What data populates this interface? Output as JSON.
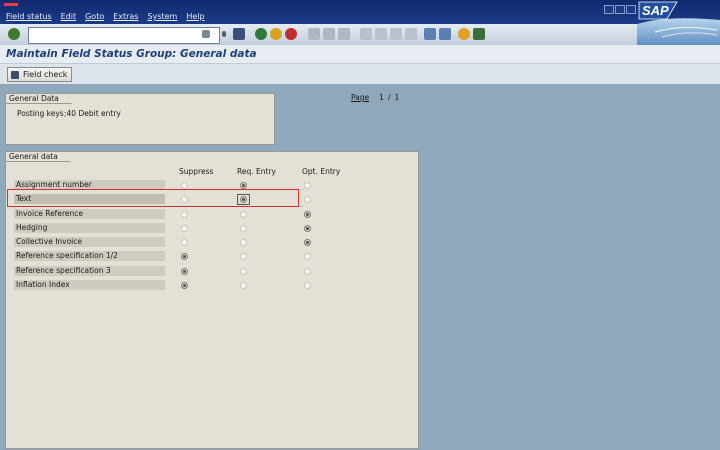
{
  "menu": {
    "items": [
      "Field status",
      "Edit",
      "Goto",
      "Extras",
      "System",
      "Help"
    ]
  },
  "toolbar": {
    "command_value": "",
    "icons": [
      "enter-icon",
      "save-icon",
      "back-icon",
      "exit-icon",
      "cancel-icon",
      "print-icon",
      "find-icon",
      "find-next-icon",
      "first-page-icon",
      "previous-page-icon",
      "next-page-icon",
      "last-page-icon",
      "new-session-icon",
      "shortcut-icon",
      "help-icon",
      "layout-icon"
    ]
  },
  "sap_logo": "SAP",
  "title": "Maintain Field Status Group: General data",
  "app_toolbar": {
    "field_check_label": "Field check"
  },
  "general_data_box": {
    "tab_label": "General Data",
    "posting_keys_label": "Posting keys",
    "posting_keys_value": ";40 Debit entry"
  },
  "page": {
    "label": "Page",
    "current": "1",
    "separator": "/",
    "total": "1"
  },
  "field_table": {
    "tab_label": "General data",
    "columns": [
      "Suppress",
      "Req. Entry",
      "Opt. Entry"
    ],
    "rows": [
      {
        "label": "Assignment number",
        "selected": "Req. Entry"
      },
      {
        "label": "Text",
        "selected": "Req. Entry"
      },
      {
        "label": "Invoice Reference",
        "selected": "Opt. Entry"
      },
      {
        "label": "Hedging",
        "selected": "Opt. Entry"
      },
      {
        "label": "Collective Invoice",
        "selected": "Opt. Entry"
      },
      {
        "label": "Reference specification 1/2",
        "selected": "Suppress"
      },
      {
        "label": "Reference specification 3",
        "selected": "Suppress"
      },
      {
        "label": "Inflation Index",
        "selected": "Suppress"
      }
    ]
  },
  "colors": {
    "menubar": "#1d3a86",
    "title_text": "#1f3e7a",
    "highlight": "#d23030",
    "background": "#8fa8bb"
  }
}
